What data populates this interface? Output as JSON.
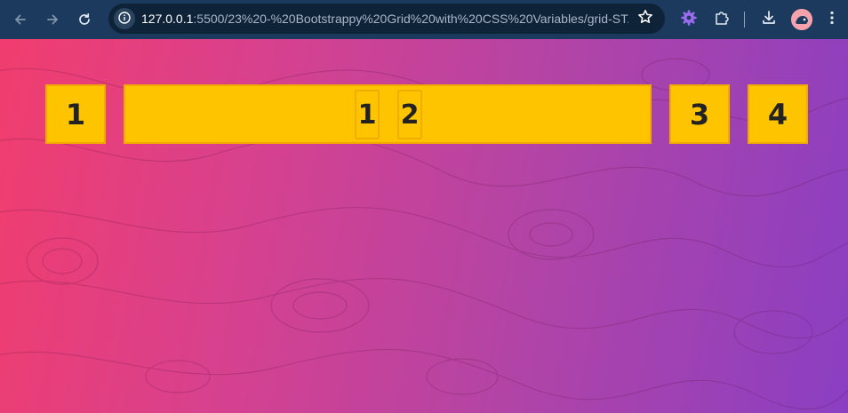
{
  "browser": {
    "url_host": "127.0.0.1",
    "url_rest": ":5500/23%20-%20Bootstrappy%20Grid%20with%20CSS%20Variables/grid-ST...",
    "icons": {
      "back": "arrow-left-icon",
      "forward": "arrow-right-icon",
      "reload": "reload-icon",
      "site_info": "info-icon",
      "bookmark": "star-icon",
      "extension": "gear-icon",
      "extensions_menu": "puzzle-icon",
      "download": "download-icon",
      "profile": "avatar",
      "menu": "kebab-menu-icon"
    }
  },
  "page": {
    "background_colors": [
      "#f13d6e",
      "#d7418e",
      "#b244a6",
      "#8a3fc2"
    ],
    "cell_color": "#ffc400",
    "cells": [
      {
        "label": "1"
      },
      {
        "sub_cells": [
          {
            "label": "1"
          },
          {
            "label": "2"
          }
        ]
      },
      {
        "label": "3"
      },
      {
        "label": "4"
      }
    ]
  }
}
